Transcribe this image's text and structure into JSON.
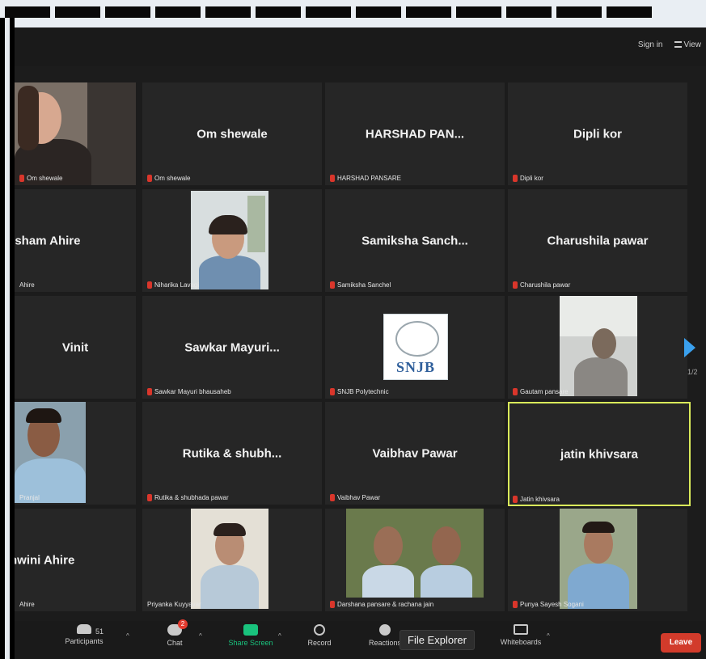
{
  "topbar": {
    "sign_in": "Sign in",
    "view": "View"
  },
  "tiles": [
    {
      "name": "",
      "label": "Om shewale"
    },
    {
      "name": "Om shewale",
      "label": "Om shewale"
    },
    {
      "name": "HARSHAD PAN...",
      "label": "HARSHAD PANSARE"
    },
    {
      "name": "Dipli kor",
      "label": "Dipli kor"
    },
    {
      "name": "esham Ahire",
      "label": "Ahire"
    },
    {
      "name": "",
      "label": "Niharika Lavagi"
    },
    {
      "name": "Samiksha Sanch...",
      "label": "Samiksha Sanchel"
    },
    {
      "name": "Charushila pawar",
      "label": "Charushila pawar"
    },
    {
      "name": "Vinit",
      "label": ""
    },
    {
      "name": "Sawkar Mayuri...",
      "label": "Sawkar Mayuri bhausaheb"
    },
    {
      "name": "",
      "label": "SNJB Polytechnic",
      "logo_text": "SNJB"
    },
    {
      "name": "",
      "label": "Gautam pansare"
    },
    {
      "name": "",
      "label": "Pranjal"
    },
    {
      "name": "Rutika & shubh...",
      "label": "Rutika & shubhada pawar"
    },
    {
      "name": "Vaibhav Pawar",
      "label": "Vaibhav Pawar"
    },
    {
      "name": "jatin khivsara",
      "label": "Jatin khivsara"
    },
    {
      "name": "hwini Ahire",
      "label": "Ahire"
    },
    {
      "name": "",
      "label": "Priyanka Kuyyavar"
    },
    {
      "name": "",
      "label": "Darshana pansare & rachana jain"
    },
    {
      "name": "",
      "label": "Punya Sayesh Sogani"
    }
  ],
  "pager": {
    "page": "1/2"
  },
  "toolbar": {
    "participants_count": "51",
    "participants": "Participants",
    "chat": "Chat",
    "chat_badge": "2",
    "share": "Share Screen",
    "record": "Record",
    "reactions": "Reactions",
    "whiteboards": "Whiteboards",
    "leave": "Leave",
    "tooltip": "File Explorer"
  }
}
